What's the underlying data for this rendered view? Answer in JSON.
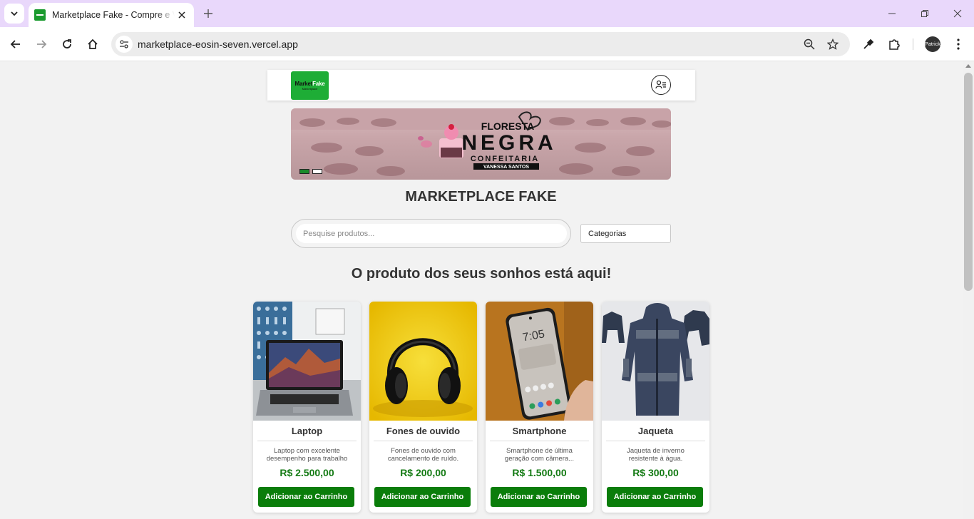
{
  "browser": {
    "tab_title": "Marketplace Fake - Compre e Venda",
    "url": "marketplace-eosin-seven.vercel.app",
    "profile_label": "Patrick"
  },
  "header": {
    "logo_main": "Market",
    "logo_highlight": "Fake",
    "logo_sub": "Marketplace"
  },
  "banner": {
    "line1": "FLORESTA",
    "line2": "NEGRA",
    "line3": "CONFEITARIA",
    "line4": "VANESSA SANTOS"
  },
  "page": {
    "title": "MARKETPLACE FAKE",
    "tagline": "O produto dos seus sonhos está aqui!"
  },
  "search": {
    "placeholder": "Pesquise produtos...",
    "category_label": "Categorias"
  },
  "products": [
    {
      "name": "Laptop",
      "description": "Laptop com excelente desempenho para trabalho ...",
      "price": "R$ 2.500,00",
      "button": "Adicionar ao Carrinho"
    },
    {
      "name": "Fones de ouvido",
      "description": "Fones de ouvido com cancelamento de ruído.",
      "price": "R$ 200,00",
      "button": "Adicionar ao Carrinho"
    },
    {
      "name": "Smartphone",
      "description": "Smartphone de última geração com câmera...",
      "price": "R$ 1.500,00",
      "button": "Adicionar ao Carrinho"
    },
    {
      "name": "Jaqueta",
      "description": "Jaqueta de inverno resistente à água.",
      "price": "R$ 300,00",
      "button": "Adicionar ao Carrinho"
    }
  ],
  "phone_screen_time": "7:05",
  "colors": {
    "brand_green": "#1ead36",
    "button_green": "#0a7d0a",
    "price_green": "#137a13",
    "tabbar": "#e9d8fb"
  }
}
